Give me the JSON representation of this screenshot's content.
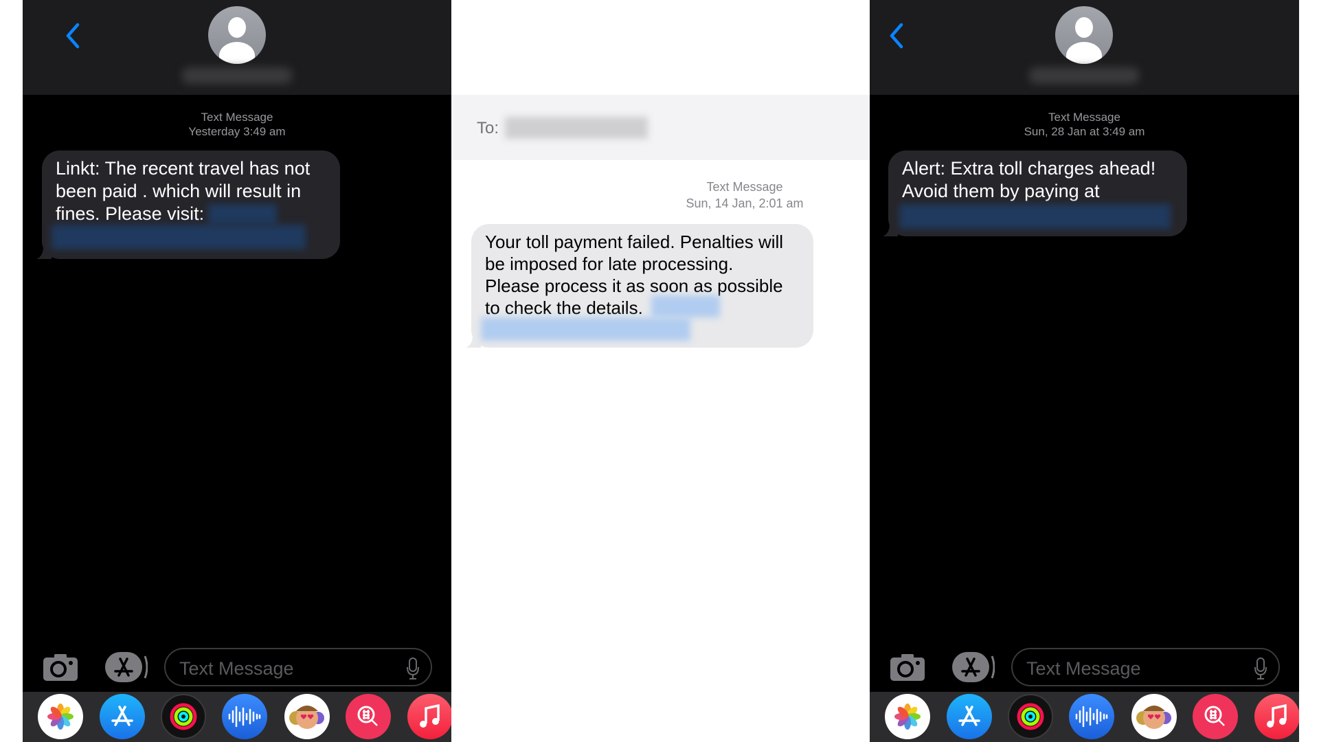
{
  "colors": {
    "accent": "#0a84ff",
    "dark_bubble": "#26252a",
    "light_bubble": "#e9e9eb",
    "header_dark": "#1c1c1e"
  },
  "left": {
    "back_icon": "chevron-left-icon",
    "timestamp_label": "Text Message",
    "timestamp": "Yesterday 3:49 am",
    "message_lines": [
      "Linkt: The recent travel has not",
      "been paid  . which will result in",
      "fines. Please visit:"
    ],
    "input_placeholder": "Text Message"
  },
  "middle": {
    "to_label": "To:",
    "timestamp_label": "Text Message",
    "timestamp": "Sun, 14 Jan, 2:01 am",
    "message_lines": [
      "Your toll payment failed. Penalties will",
      "be imposed for late processing.",
      "Please process it as soon as possible",
      "to check the details."
    ]
  },
  "right": {
    "back_icon": "chevron-left-icon",
    "timestamp_label": "Text Message",
    "timestamp": "Sun, 28 Jan at 3:49 am",
    "message_lines": [
      "Alert: Extra toll charges ahead!",
      "Avoid them by paying at"
    ],
    "input_placeholder": "Text Message"
  },
  "dock_apps": [
    "photos",
    "app-store",
    "activity",
    "voice-memos",
    "memoji",
    "search-images",
    "music"
  ]
}
